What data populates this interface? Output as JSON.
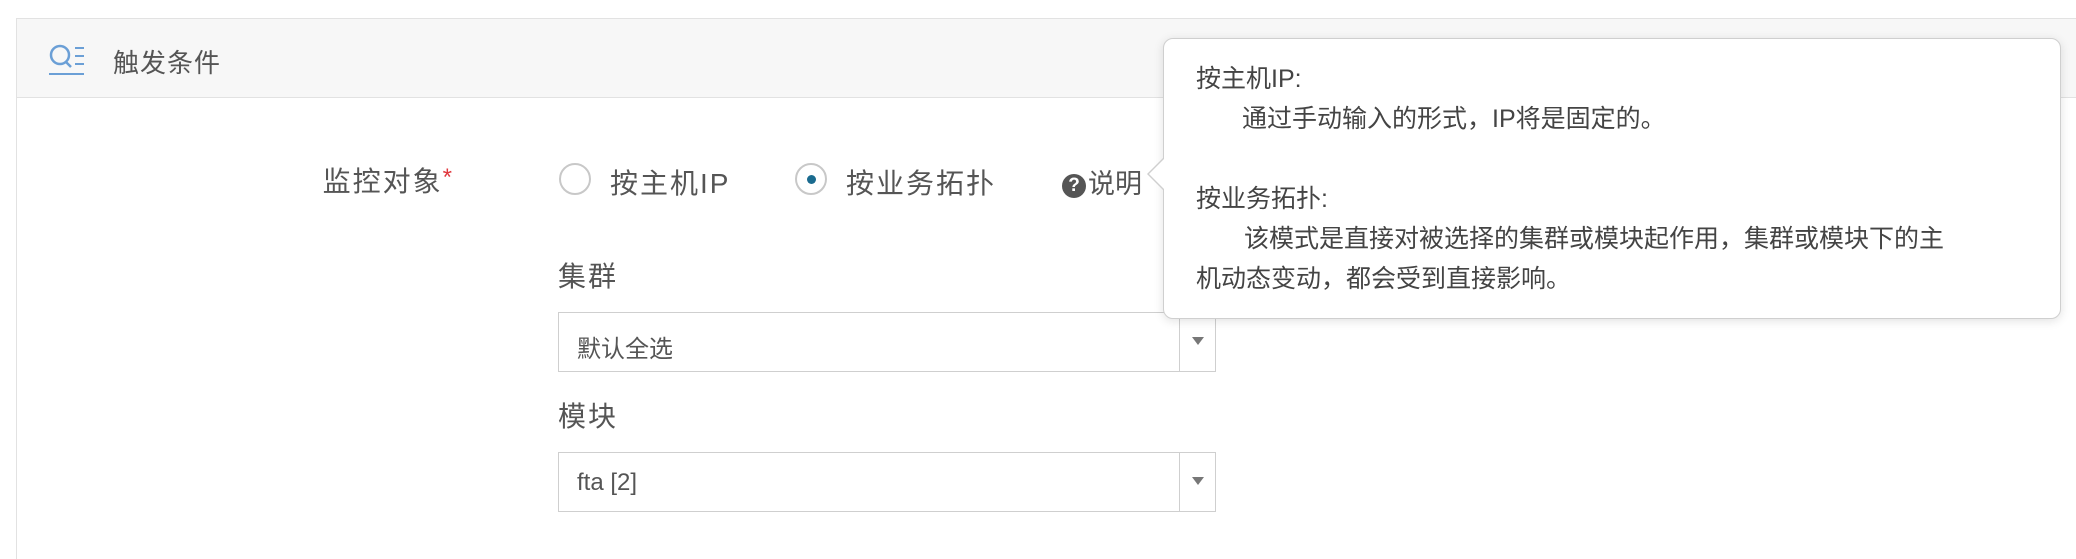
{
  "section": {
    "title": "触发条件",
    "icon": "search-list-icon"
  },
  "monitor_target": {
    "label": "监控对象",
    "required_mark": "*",
    "options": [
      {
        "label": "按主机IP",
        "checked": false
      },
      {
        "label": "按业务拓扑",
        "checked": true
      }
    ],
    "help_icon": "question-circle-icon",
    "help_label": "说明"
  },
  "cluster": {
    "label": "集群",
    "value": "默认全选"
  },
  "module": {
    "label": "模块",
    "value": "fta [2]"
  },
  "tooltip": {
    "host_ip_title": "按主机IP:",
    "host_ip_desc": "通过手动输入的形式，IP将是固定的。",
    "topology_title": "按业务拓扑:",
    "topology_desc_line1": "该模式是直接对被选择的集群或模块起作用，集群或模块下的主",
    "topology_desc_line2": "机动态变动，都会受到直接影响。"
  },
  "colors": {
    "accent": "#1a6b8f",
    "required": "#e0383e",
    "icon_blue": "#6b9fd6"
  }
}
